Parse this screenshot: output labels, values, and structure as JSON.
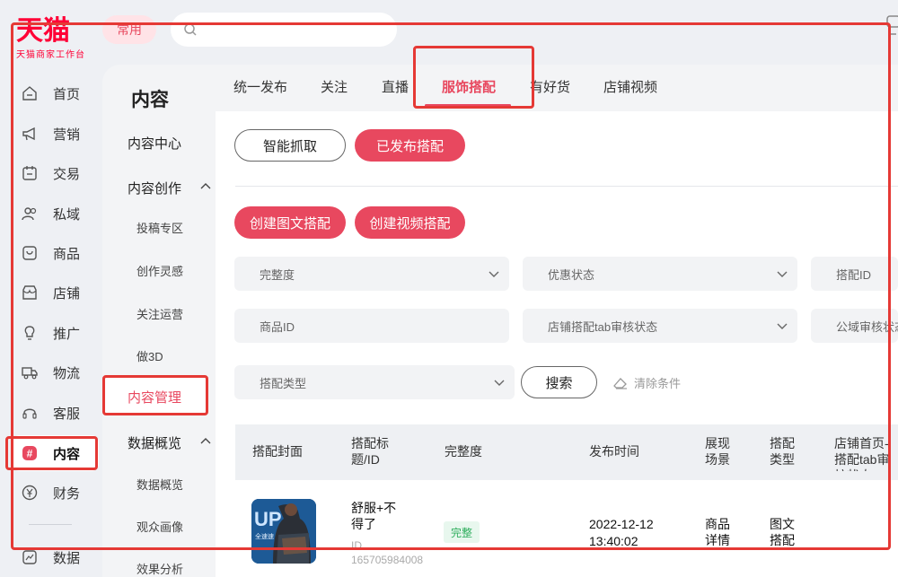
{
  "brand": {
    "logo_text": "天猫",
    "logo_sub": "天猫商家工作台",
    "color": "#ff0036"
  },
  "topbar": {
    "common_label": "常用",
    "search_placeholder": ""
  },
  "sidebar": {
    "items": [
      {
        "label": "首页",
        "icon": "home-icon"
      },
      {
        "label": "营销",
        "icon": "megaphone-icon"
      },
      {
        "label": "交易",
        "icon": "trade-icon"
      },
      {
        "label": "私域",
        "icon": "users-icon"
      },
      {
        "label": "商品",
        "icon": "product-icon"
      },
      {
        "label": "店铺",
        "icon": "store-icon"
      },
      {
        "label": "推广",
        "icon": "bulb-icon"
      },
      {
        "label": "物流",
        "icon": "truck-icon"
      },
      {
        "label": "客服",
        "icon": "headset-icon"
      },
      {
        "label": "内容",
        "icon": "hash-icon",
        "active": true
      },
      {
        "label": "财务",
        "icon": "yen-icon"
      },
      {
        "label": "数据",
        "icon": "chart-icon"
      }
    ]
  },
  "subnav": {
    "title": "内容",
    "section_center": "内容中心",
    "section_create": "内容创作",
    "create_items": [
      "投稿专区",
      "创作灵感",
      "关注运营",
      "做3D"
    ],
    "active_item": "内容管理",
    "section_data": "数据概览",
    "data_items": [
      "数据概览",
      "观众画像",
      "效果分析"
    ]
  },
  "tabs": [
    "统一发布",
    "关注",
    "直播",
    "服饰搭配",
    "有好货",
    "店铺视频"
  ],
  "active_tab": "服饰搭配",
  "mode_buttons": {
    "smart_fetch": "智能抓取",
    "published": "已发布搭配"
  },
  "create_buttons": {
    "image_text": "创建图文搭配",
    "video": "创建视频搭配"
  },
  "filters": {
    "completeness": "完整度",
    "discount_status": "优惠状态",
    "match_id": "搭配ID",
    "product_id": "商品ID",
    "store_tab_review": "店铺搭配tab审核状态",
    "public_review": "公域审核状态",
    "match_type": "搭配类型",
    "search_button": "搜索",
    "clear_label": "清除条件"
  },
  "table": {
    "headers": {
      "cover": "搭配封面",
      "title_id": "搭配标题/ID",
      "completeness": "完整度",
      "publish_time": "发布时间",
      "scene": "展现场景",
      "type": "搭配类型",
      "store_review": "店铺首页-搭配tab审核状态"
    },
    "rows": [
      {
        "title": "舒服+不得了",
        "id": "ID 165705984008",
        "completeness": "完整",
        "publish_date": "2022-12-12",
        "publish_time": "13:40:02",
        "scene": "商品详情",
        "type": "图文搭配"
      }
    ]
  },
  "colors": {
    "accent": "#e8485f",
    "success": "#2fae5d",
    "annotation": "#e53935"
  }
}
